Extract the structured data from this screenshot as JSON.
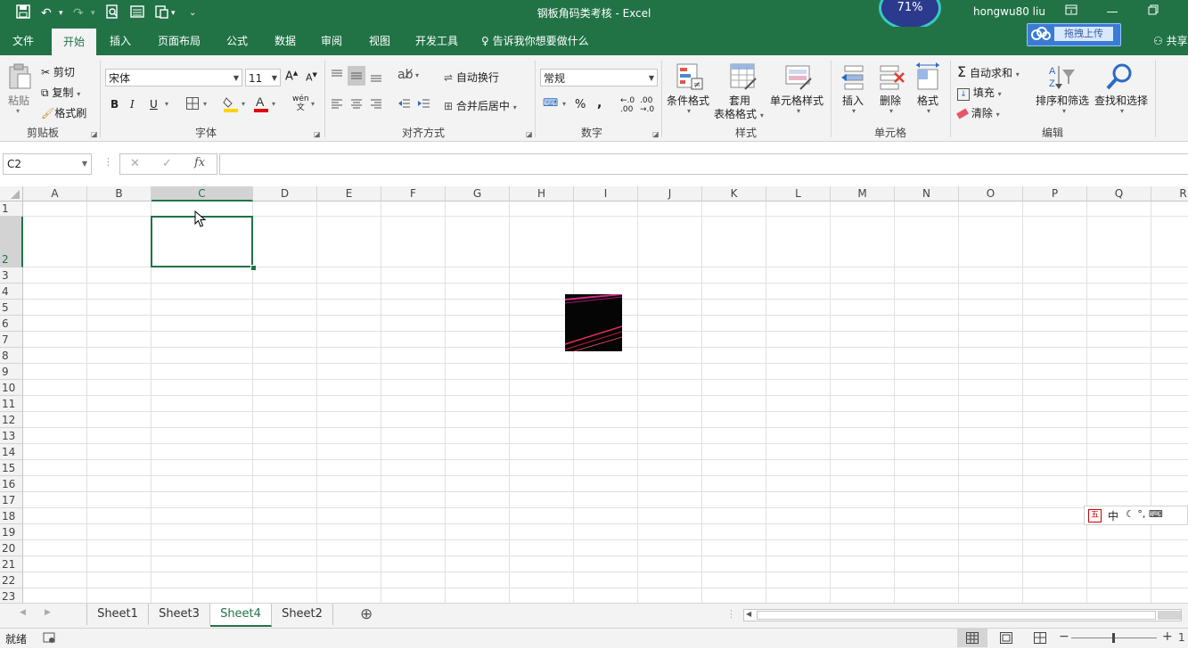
{
  "window": {
    "title": "钢板角码类考核  -  Excel",
    "user": "hongwu80 liu",
    "badge_text": "71%"
  },
  "qat": {
    "save": "💾",
    "undo": "↶",
    "redo": "↷",
    "customize": "⌄"
  },
  "tabs": [
    "文件",
    "开始",
    "插入",
    "页面布局",
    "公式",
    "数据",
    "审阅",
    "视图",
    "开发工具"
  ],
  "active_tab": "开始",
  "tell_me": "告诉我你想要做什么",
  "upload_label": "拖拽上传",
  "share_label": "共享",
  "ribbon": {
    "clipboard": {
      "label": "剪贴板",
      "paste": "粘贴",
      "cut": "剪切",
      "copy": "复制",
      "format_painter": "格式刷"
    },
    "font": {
      "label": "字体",
      "name": "宋体",
      "size": "11",
      "bold": "B",
      "italic": "I",
      "underline": "U",
      "grow": "A",
      "shrink": "A",
      "wen": "wén"
    },
    "align": {
      "label": "对齐方式",
      "wrap": "自动换行",
      "merge": "合并后居中"
    },
    "number": {
      "label": "数字",
      "format": "常规",
      "percent": "%",
      "comma": ",",
      "inc_dec": ".00",
      "dec_dec": ".0"
    },
    "styles": {
      "label": "样式",
      "conditional": "条件格式",
      "table_1": "套用",
      "table_2": "表格格式",
      "cell_styles": "单元格样式"
    },
    "cells": {
      "label": "单元格",
      "insert": "插入",
      "delete": "删除",
      "format": "格式"
    },
    "editing": {
      "label": "编辑",
      "autosum": "自动求和",
      "fill": "填充",
      "clear": "清除",
      "sort": "排序和筛选",
      "find": "查找和选择"
    }
  },
  "formula_bar": {
    "name_box": "C2",
    "cancel": "✕",
    "enter": "✓",
    "fx": "fx",
    "value": ""
  },
  "columns": [
    "A",
    "B",
    "C",
    "D",
    "E",
    "F",
    "G",
    "H",
    "I",
    "J",
    "K",
    "L",
    "M",
    "N",
    "O",
    "P",
    "Q",
    "R"
  ],
  "rows": [
    "1",
    "2",
    "3",
    "4",
    "5",
    "6",
    "7",
    "8",
    "9",
    "10",
    "11",
    "12",
    "13",
    "14",
    "15",
    "16",
    "17",
    "18",
    "19",
    "20",
    "21",
    "22",
    "23"
  ],
  "selected_cell": "C2",
  "sheets": [
    "Sheet1",
    "Sheet3",
    "Sheet4",
    "Sheet2"
  ],
  "active_sheet": "Sheet4",
  "add_sheet": "⊕",
  "status": {
    "ready": "就绪",
    "zoom_minus": "−",
    "zoom_plus": "+",
    "zoom_percent": "1"
  },
  "ime": {
    "mode": "中",
    "items": "☾ °, ⌨"
  },
  "colors": {
    "accent": "#217346",
    "ribbon_bg": "#f3f3f3"
  }
}
